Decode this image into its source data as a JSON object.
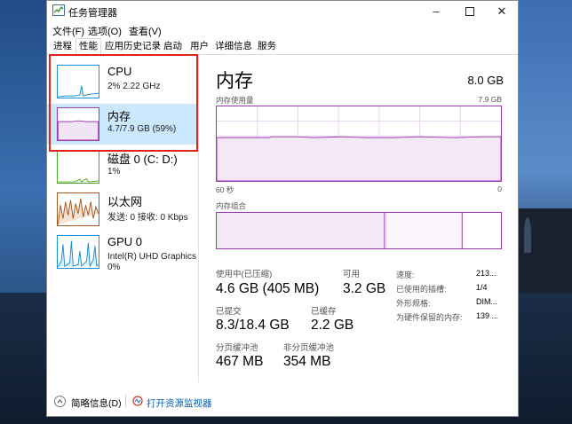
{
  "window": {
    "title": "任务管理器"
  },
  "menu": [
    "文件(F)",
    "选项(O)",
    "查看(V)"
  ],
  "tabs": [
    "进程",
    "性能",
    "应用历史记录",
    "启动",
    "用户",
    "详细信息",
    "服务"
  ],
  "active_tab_index": 1,
  "sidebar": [
    {
      "name": "CPU",
      "line1": "2%  2.22 GHz",
      "color": "#1a8fd1"
    },
    {
      "name": "内存",
      "line1": "4.7/7.9 GB (59%)",
      "color": "#9b3ab0",
      "selected": true
    },
    {
      "name": "磁盘 0 (C: D:)",
      "line1": "1%",
      "color": "#4ca628"
    },
    {
      "name": "以太网",
      "line1": "发送: 0  接收: 0 Kbps",
      "color": "#a8561a"
    },
    {
      "name": "GPU 0",
      "line1": "Intel(R) UHD Graphics",
      "line2": "0%",
      "color": "#1a8fd1"
    }
  ],
  "main": {
    "title": "内存",
    "total": "8.0 GB",
    "usage_label": "内存使用量",
    "usage_max": "7.9 GB",
    "time_left": "60 秒",
    "time_right": "0",
    "composition_label": "内存组合",
    "memory_usage_fraction": 0.59,
    "stats": {
      "in_use_label": "使用中(已压缩)",
      "in_use_value": "4.6 GB (405 MB)",
      "available_label": "可用",
      "available_value": "3.2 GB",
      "committed_label": "已提交",
      "committed_value": "8.3/18.4 GB",
      "cached_label": "已缓存",
      "cached_value": "2.2 GB",
      "paged_label": "分页缓冲池",
      "paged_value": "467 MB",
      "nonpaged_label": "非分页缓冲池",
      "nonpaged_value": "354 MB"
    },
    "details": [
      {
        "key": "速度:",
        "value": "213..."
      },
      {
        "key": "已使用的插槽:",
        "value": "1/4"
      },
      {
        "key": "外形规格:",
        "value": "DIM..."
      },
      {
        "key": "为硬件保留的内存:",
        "value": "139 ..."
      }
    ]
  },
  "footer": {
    "brief_label": "简略信息(D)",
    "resmon_label": "打开资源监视器"
  }
}
